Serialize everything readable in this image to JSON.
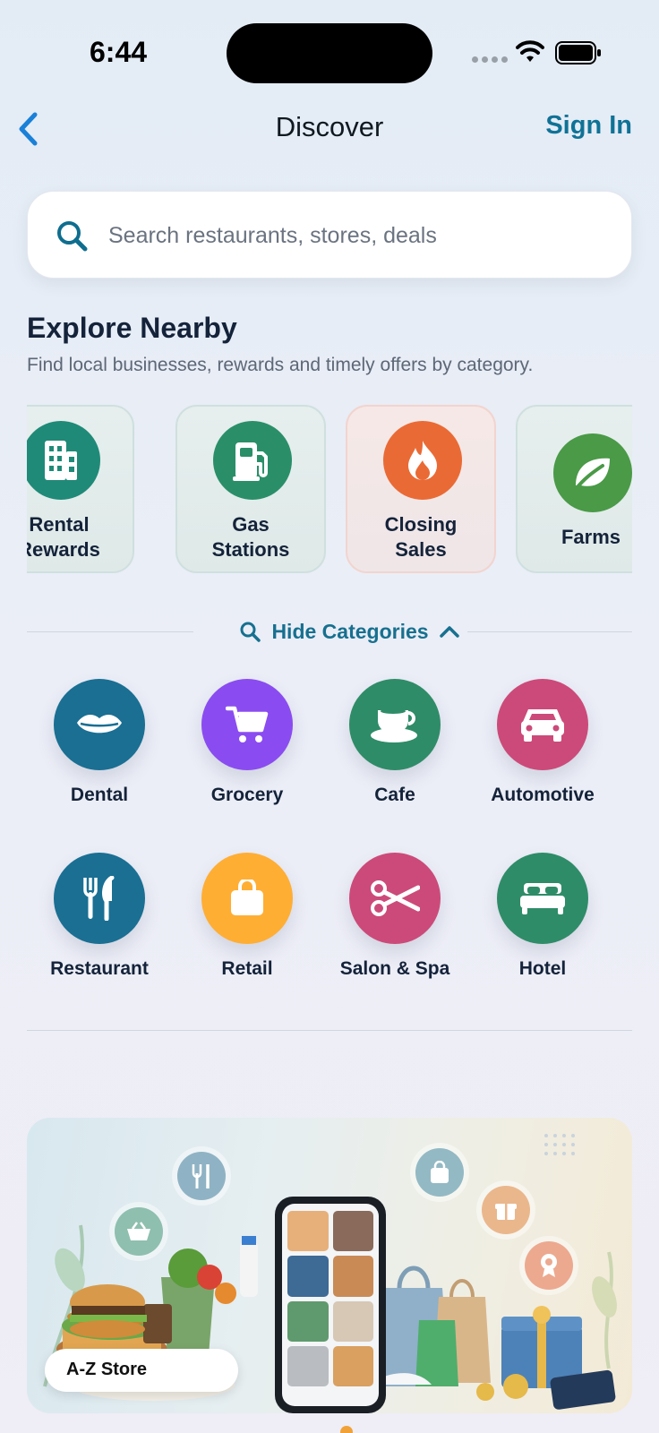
{
  "status_bar": {
    "time": "6:44"
  },
  "nav": {
    "title": "Discover",
    "sign_in": "Sign In"
  },
  "search": {
    "placeholder": "Search restaurants, stores, deals"
  },
  "explore": {
    "title": "Explore Nearby",
    "subtitle": "Find local businesses, rewards and timely offers by category.",
    "cards": [
      {
        "label_line1": "Rental",
        "label_line2": "Rewards",
        "icon": "building-icon",
        "color": "#1f8a78"
      },
      {
        "label_line1": "Gas",
        "label_line2": "Stations",
        "icon": "gas-pump-icon",
        "color": "#2a8f69"
      },
      {
        "label_line1": "Closing",
        "label_line2": "Sales",
        "icon": "flame-icon",
        "color": "#ea6a35"
      },
      {
        "label_line1": "Farms",
        "label_line2": "",
        "icon": "leaf-icon",
        "color": "#4a9a47"
      }
    ]
  },
  "categories_toggle": {
    "label": "Hide Categories"
  },
  "categories": [
    {
      "label": "Dental",
      "icon": "lips-icon",
      "color": "#1a6f93"
    },
    {
      "label": "Grocery",
      "icon": "cart-icon",
      "color": "#8a4cf0"
    },
    {
      "label": "Cafe",
      "icon": "coffee-cup-icon",
      "color": "#2f8c68"
    },
    {
      "label": "Automotive",
      "icon": "car-icon",
      "color": "#cc4a79"
    },
    {
      "label": "Restaurant",
      "icon": "fork-knife-icon",
      "color": "#1a6f93"
    },
    {
      "label": "Retail",
      "icon": "shopping-bag-icon",
      "color": "#ffae34"
    },
    {
      "label": "Salon & Spa",
      "icon": "scissors-icon",
      "color": "#cc4a79"
    },
    {
      "label": "Hotel",
      "icon": "bed-icon",
      "color": "#2f8c68"
    }
  ],
  "banner": {
    "store_label": "A-Z Store"
  }
}
